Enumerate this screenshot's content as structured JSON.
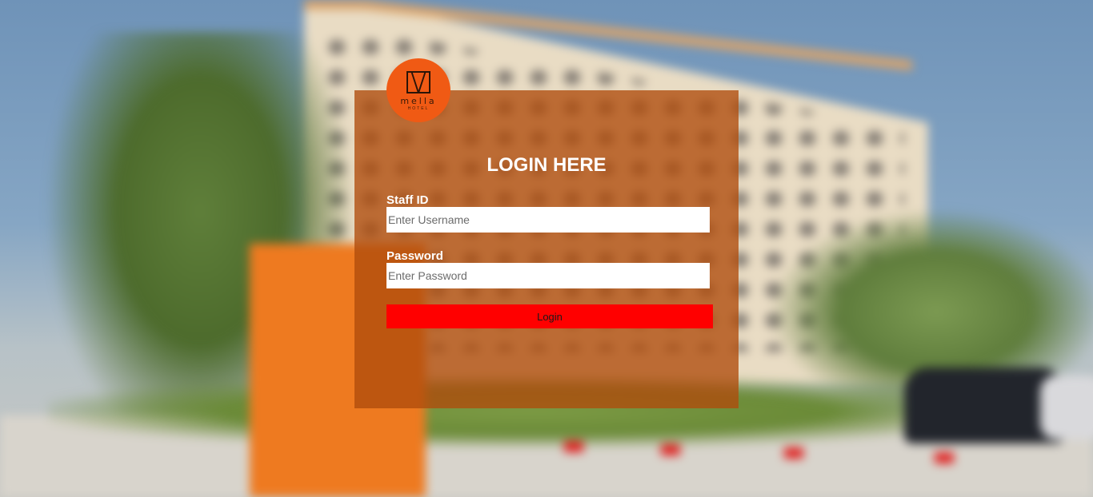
{
  "logo": {
    "word": "mella",
    "sub": "HOTEL"
  },
  "login": {
    "title": "LOGIN HERE",
    "staff_id_label": "Staff ID",
    "staff_id_placeholder": "Enter Username",
    "staff_id_value": "",
    "password_label": "Password",
    "password_placeholder": "Enter Password",
    "password_value": "",
    "submit_label": "Login"
  },
  "colors": {
    "card": "#b04c0c",
    "button": "#ff0000",
    "logo": "#f05a14"
  }
}
